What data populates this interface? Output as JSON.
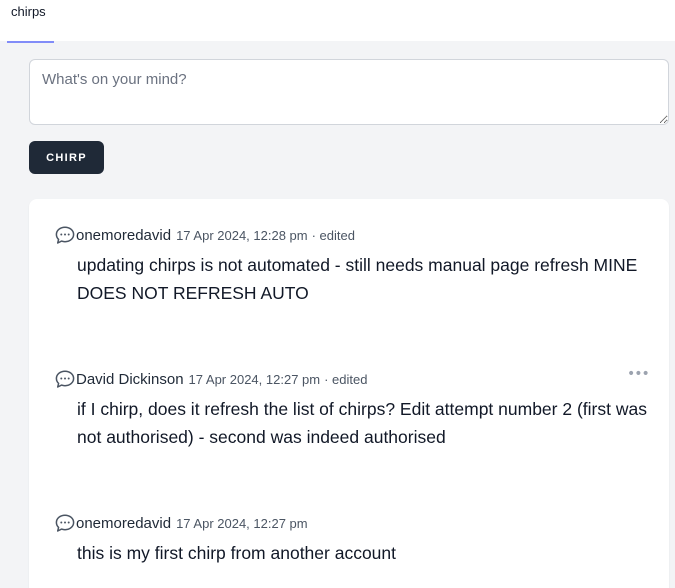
{
  "nav": {
    "link_label": "chirps"
  },
  "composer": {
    "placeholder": "What's on your mind?",
    "value": ""
  },
  "actions": {
    "chirp_label": "CHIRP"
  },
  "colors": {
    "accent": "#818cf8",
    "button_bg": "#1f2937",
    "page_bg": "#f3f4f6"
  },
  "chirps": [
    {
      "author": "onemoredavid",
      "date": "17 Apr 2024, 12:28 pm",
      "edited": "· edited",
      "message": "updating chirps is not automated - still needs manual page refresh MINE DOES NOT REFRESH AUTO",
      "icon": "chat-bubble-icon"
    },
    {
      "author": "David Dickinson",
      "date": "17 Apr 2024, 12:27 pm",
      "edited": "· edited",
      "message": "if I chirp, does it refresh the list of chirps? Edit attempt number 2 (first was not authorised) - second was indeed authorised",
      "icon": "chat-bubble-icon",
      "more": "•••"
    },
    {
      "author": "onemoredavid",
      "date": "17 Apr 2024, 12:27 pm",
      "message": "this is my first chirp from another account",
      "icon": "chat-bubble-icon"
    }
  ]
}
